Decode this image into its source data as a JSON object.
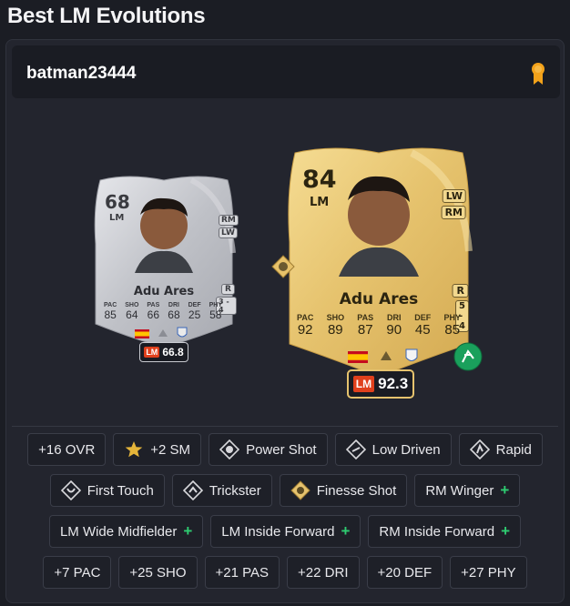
{
  "page": {
    "title": "Best LM Evolutions"
  },
  "user": {
    "name": "batman23444"
  },
  "base_card": {
    "rating": "68",
    "position": "LM",
    "alt_positions": [
      "RM",
      "LW"
    ],
    "foot": "R",
    "skills_weak": "3 - 4",
    "name": "Adu Ares",
    "stat_labels": [
      "PAC",
      "SHO",
      "PAS",
      "DRI",
      "DEF",
      "PHY"
    ],
    "stat_values": [
      "85",
      "64",
      "66",
      "68",
      "25",
      "58"
    ],
    "badge_pos": "LM",
    "badge_score": "66.8"
  },
  "evo_card": {
    "rating": "84",
    "position": "LM",
    "alt_positions": [
      "LW",
      "RM"
    ],
    "foot": "R",
    "skills_weak": "5 - 4",
    "name": "Adu Ares",
    "stat_labels": [
      "PAC",
      "SHO",
      "PAS",
      "DRI",
      "DEF",
      "PHY"
    ],
    "stat_values": [
      "92",
      "89",
      "87",
      "90",
      "45",
      "85"
    ],
    "badge_pos": "LM",
    "badge_score": "92.3"
  },
  "tags": {
    "row1": [
      {
        "label": "+16 OVR",
        "icon": ""
      },
      {
        "label": "+2 SM",
        "icon": "star-icon"
      },
      {
        "label": "Power Shot",
        "icon": "playstyle-icon"
      },
      {
        "label": "Low Driven",
        "icon": "playstyle-icon"
      },
      {
        "label": "Rapid",
        "icon": "playstyle-icon"
      }
    ],
    "row2": [
      {
        "label": "First Touch",
        "icon": "playstyle-icon"
      },
      {
        "label": "Trickster",
        "icon": "playstyle-icon"
      },
      {
        "label": "Finesse Shot",
        "icon": "playstyle-plus-icon"
      },
      {
        "label": "RM Winger",
        "icon": "plus"
      }
    ],
    "row3": [
      {
        "label": "LM Wide Midfielder",
        "icon": "plus"
      },
      {
        "label": "LM Inside Forward",
        "icon": "plus"
      },
      {
        "label": "RM Inside Forward",
        "icon": "plus"
      }
    ],
    "row4": [
      {
        "label": "+7 PAC"
      },
      {
        "label": "+25 SHO"
      },
      {
        "label": "+21 PAS"
      },
      {
        "label": "+22 DRI"
      },
      {
        "label": "+20 DEF"
      },
      {
        "label": "+27 PHY"
      }
    ]
  },
  "colors": {
    "accent_plus": "#2ecc71",
    "gold": "#e7c26a",
    "silver": "#c9cbd0",
    "badge_red": "#e0401c"
  }
}
